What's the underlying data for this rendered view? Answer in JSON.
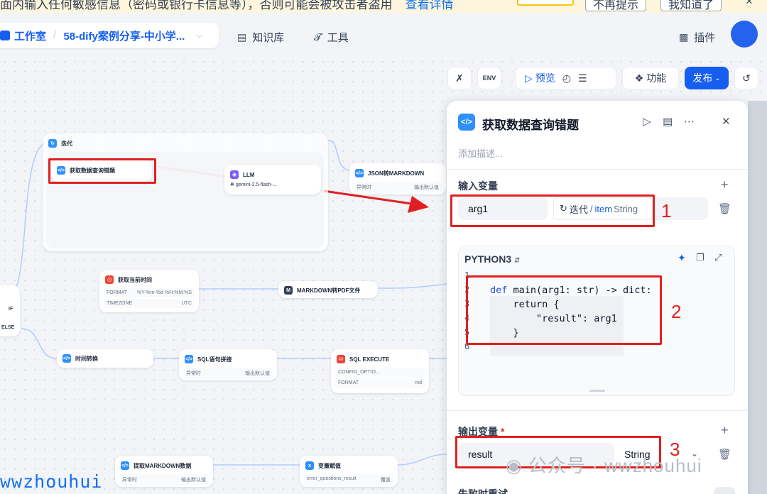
{
  "banner": {
    "text": "面内输入任何敏感信息（密码或银行卡信息等），否则可能会被攻击者盗用",
    "link": "查看详情",
    "no_remind": "不再提示",
    "got_it": "我知道了",
    "close": "×"
  },
  "nav": {
    "studio": "工作室",
    "app_name": "58-dify案例分享-中小学...",
    "knowledge": "知识库",
    "tools": "工具",
    "plugins": "插件"
  },
  "toolbar": {
    "env": "ENV",
    "preview": "预览",
    "features": "功能",
    "publish": "发布"
  },
  "canvas": {
    "iteration_title": "迭代",
    "node_get_data": "获取数据查询错题",
    "node_llm": "LLM",
    "llm_model": "gemini-2.5-flash-...",
    "node_json_md": "JSON转MARKDOWN",
    "json_md_row_left": "异常时",
    "json_md_row_right": "输出默认值",
    "node_time": "获取当前时间",
    "time_format_label": "FORMAT",
    "time_format_value": "%Y-%m-%d %H:%M:%S",
    "time_tz_label": "TIMEZONE",
    "time_tz_value": "UTC",
    "node_md_pdf": "MARKDOWN转PDF文件",
    "if_label": "IF",
    "else_label": "ELSE",
    "node_time_convert": "时间转换",
    "node_sql_concat": "SQL语句拼接",
    "sql_concat_row_left": "异常时",
    "sql_concat_row_right": "输出默认值",
    "node_sql_exec": "SQL EXECUTE",
    "sql_exec_row1": "CONFIG_OPTIO...",
    "sql_exec_row2_label": "FORMAT",
    "sql_exec_row2_value": "md",
    "node_extract_md": "提取MARKDOWN数据",
    "extract_row_left": "异常时",
    "extract_row_right": "输出默认值",
    "node_assign": "变量赋值",
    "assign_row_left": "error_questions_result",
    "assign_row_right": "覆盖",
    "watermark_left": "wwzhouhui"
  },
  "panel": {
    "title": "获取数据查询错题",
    "description_placeholder": "添加描述...",
    "input_section": "输入变量",
    "input_var_name": "arg1",
    "input_var_source": "迭代",
    "input_var_item": "item",
    "input_var_type": "String",
    "code_lang": "PYTHON3",
    "code_lines": [
      {
        "n": "1",
        "text": ""
      },
      {
        "n": "2",
        "text": "def main(arg1: str) -> dict:"
      },
      {
        "n": "3",
        "text": "    return {"
      },
      {
        "n": "4",
        "text": "        \"result\": arg1"
      },
      {
        "n": "5",
        "text": "    }"
      },
      {
        "n": "6",
        "text": ""
      }
    ],
    "output_section": "输出变量",
    "output_required": "*",
    "output_var_name": "result",
    "output_var_type": "String",
    "next_section": "失败时重试",
    "label_1": "1",
    "label_2": "2",
    "label_3": "3",
    "watermark": "公众号 · wwzhouhui"
  },
  "colors": {
    "accent": "#155eef",
    "annotation_red": "#e02020",
    "node_blue": "#2e90fa"
  }
}
